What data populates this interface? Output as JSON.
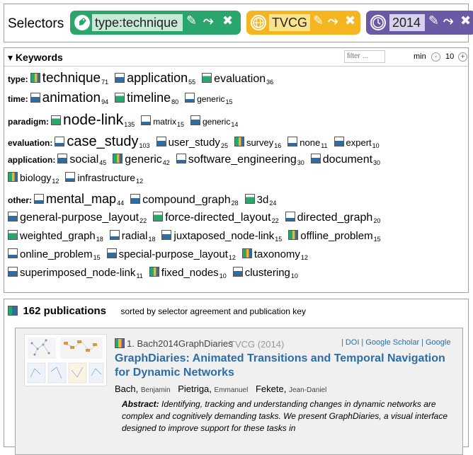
{
  "selectors": {
    "title": "Selectors",
    "chips": [
      {
        "value": "type:technique",
        "icon": "tag-icon"
      },
      {
        "value": "TVCG",
        "icon": "globe-icon"
      },
      {
        "value": "2014",
        "icon": "clock-icon"
      }
    ],
    "edit_glyph": "✎",
    "invert_glyph": "⤳",
    "remove_glyph": "✖"
  },
  "keywords": {
    "title": "▾ Keywords",
    "filter_placeholder": "filter ...",
    "min_label": "min",
    "minus": "-",
    "min_value": "10",
    "plus": "+",
    "rows": [
      {
        "category": "type:",
        "items": [
          {
            "label": "technique",
            "count": "71",
            "size": 19
          },
          {
            "label": "application",
            "count": "55",
            "size": 18
          },
          {
            "label": "evaluation",
            "count": "36",
            "size": 16
          }
        ]
      },
      {
        "category": "time:",
        "items": [
          {
            "label": "animation",
            "count": "94",
            "size": 19
          },
          {
            "label": "timeline",
            "count": "80",
            "size": 18
          },
          {
            "label": "generic",
            "count": "15",
            "size": 12
          }
        ]
      },
      {
        "category": "paradigm:",
        "items": [
          {
            "label": "node-link",
            "count": "135",
            "size": 21
          },
          {
            "label": "matrix",
            "count": "15",
            "size": 12
          },
          {
            "label": "generic",
            "count": "14",
            "size": 12
          }
        ]
      },
      {
        "category": "evaluation:",
        "items": [
          {
            "label": "case_study",
            "count": "103",
            "size": 20
          },
          {
            "label": "user_study",
            "count": "25",
            "size": 15
          },
          {
            "label": "survey",
            "count": "16",
            "size": 13
          },
          {
            "label": "none",
            "count": "11",
            "size": 13
          },
          {
            "label": "expert",
            "count": "10",
            "size": 13
          }
        ]
      },
      {
        "category": "application:",
        "items": [
          {
            "label": "social",
            "count": "45",
            "size": 16
          },
          {
            "label": "generic",
            "count": "42",
            "size": 16
          },
          {
            "label": "software_engineering",
            "count": "30",
            "size": 16
          },
          {
            "label": "document",
            "count": "30",
            "size": 16
          }
        ]
      },
      {
        "category": "",
        "items": [
          {
            "label": "biology",
            "count": "12",
            "size": 14
          },
          {
            "label": "infrastructure",
            "count": "12",
            "size": 14
          }
        ]
      },
      {
        "category": "other:",
        "items": [
          {
            "label": "mental_map",
            "count": "44",
            "size": 18
          },
          {
            "label": "compound_graph",
            "count": "28",
            "size": 16
          },
          {
            "label": "3d",
            "count": "24",
            "size": 15
          }
        ]
      },
      {
        "category": "",
        "items": [
          {
            "label": "general-purpose_layout",
            "count": "22",
            "size": 16
          },
          {
            "label": "force-directed_layout",
            "count": "22",
            "size": 16
          },
          {
            "label": "directed_graph",
            "count": "20",
            "size": 16
          }
        ]
      },
      {
        "category": "",
        "items": [
          {
            "label": "weighted_graph",
            "count": "18",
            "size": 15
          },
          {
            "label": "radial",
            "count": "18",
            "size": 15
          },
          {
            "label": "juxtaposed_node-link",
            "count": "15",
            "size": 15
          },
          {
            "label": "offline_problem",
            "count": "15",
            "size": 15
          }
        ]
      },
      {
        "category": "",
        "items": [
          {
            "label": "online_problem",
            "count": "15",
            "size": 15
          },
          {
            "label": "special-purpose_layout",
            "count": "12",
            "size": 15
          },
          {
            "label": "taxonomy",
            "count": "12",
            "size": 15
          }
        ]
      },
      {
        "category": "",
        "items": [
          {
            "label": "superimposed_node-link",
            "count": "11",
            "size": 15
          },
          {
            "label": "fixed_nodes",
            "count": "10",
            "size": 15
          },
          {
            "label": "clustering",
            "count": "10",
            "size": 15
          }
        ]
      }
    ]
  },
  "publications": {
    "count": "162 publications",
    "sort_text": "sorted by selector agreement and publication key",
    "items": [
      {
        "rank": "1. Bach2014GraphDiaries",
        "venue": "TVCG (2014)",
        "links": [
          "DOI",
          "Google Scholar",
          "Google"
        ],
        "title": "GraphDiaries: Animated Transitions and Temporal Navigation for Dynamic Networks",
        "authors": [
          {
            "last": "Bach,",
            "first": "Benjamin"
          },
          {
            "last": "Pietriga,",
            "first": "Emmanuel"
          },
          {
            "last": "Fekete,",
            "first": "Jean-Daniel"
          }
        ],
        "abstract_label": "Abstract:",
        "abstract_text": "Identifying, tracking and understanding changes in dynamic networks are complex and cognitively demanding tasks. We present GraphDiaries, a visual interface designed to improve support for these tasks in"
      }
    ]
  }
}
